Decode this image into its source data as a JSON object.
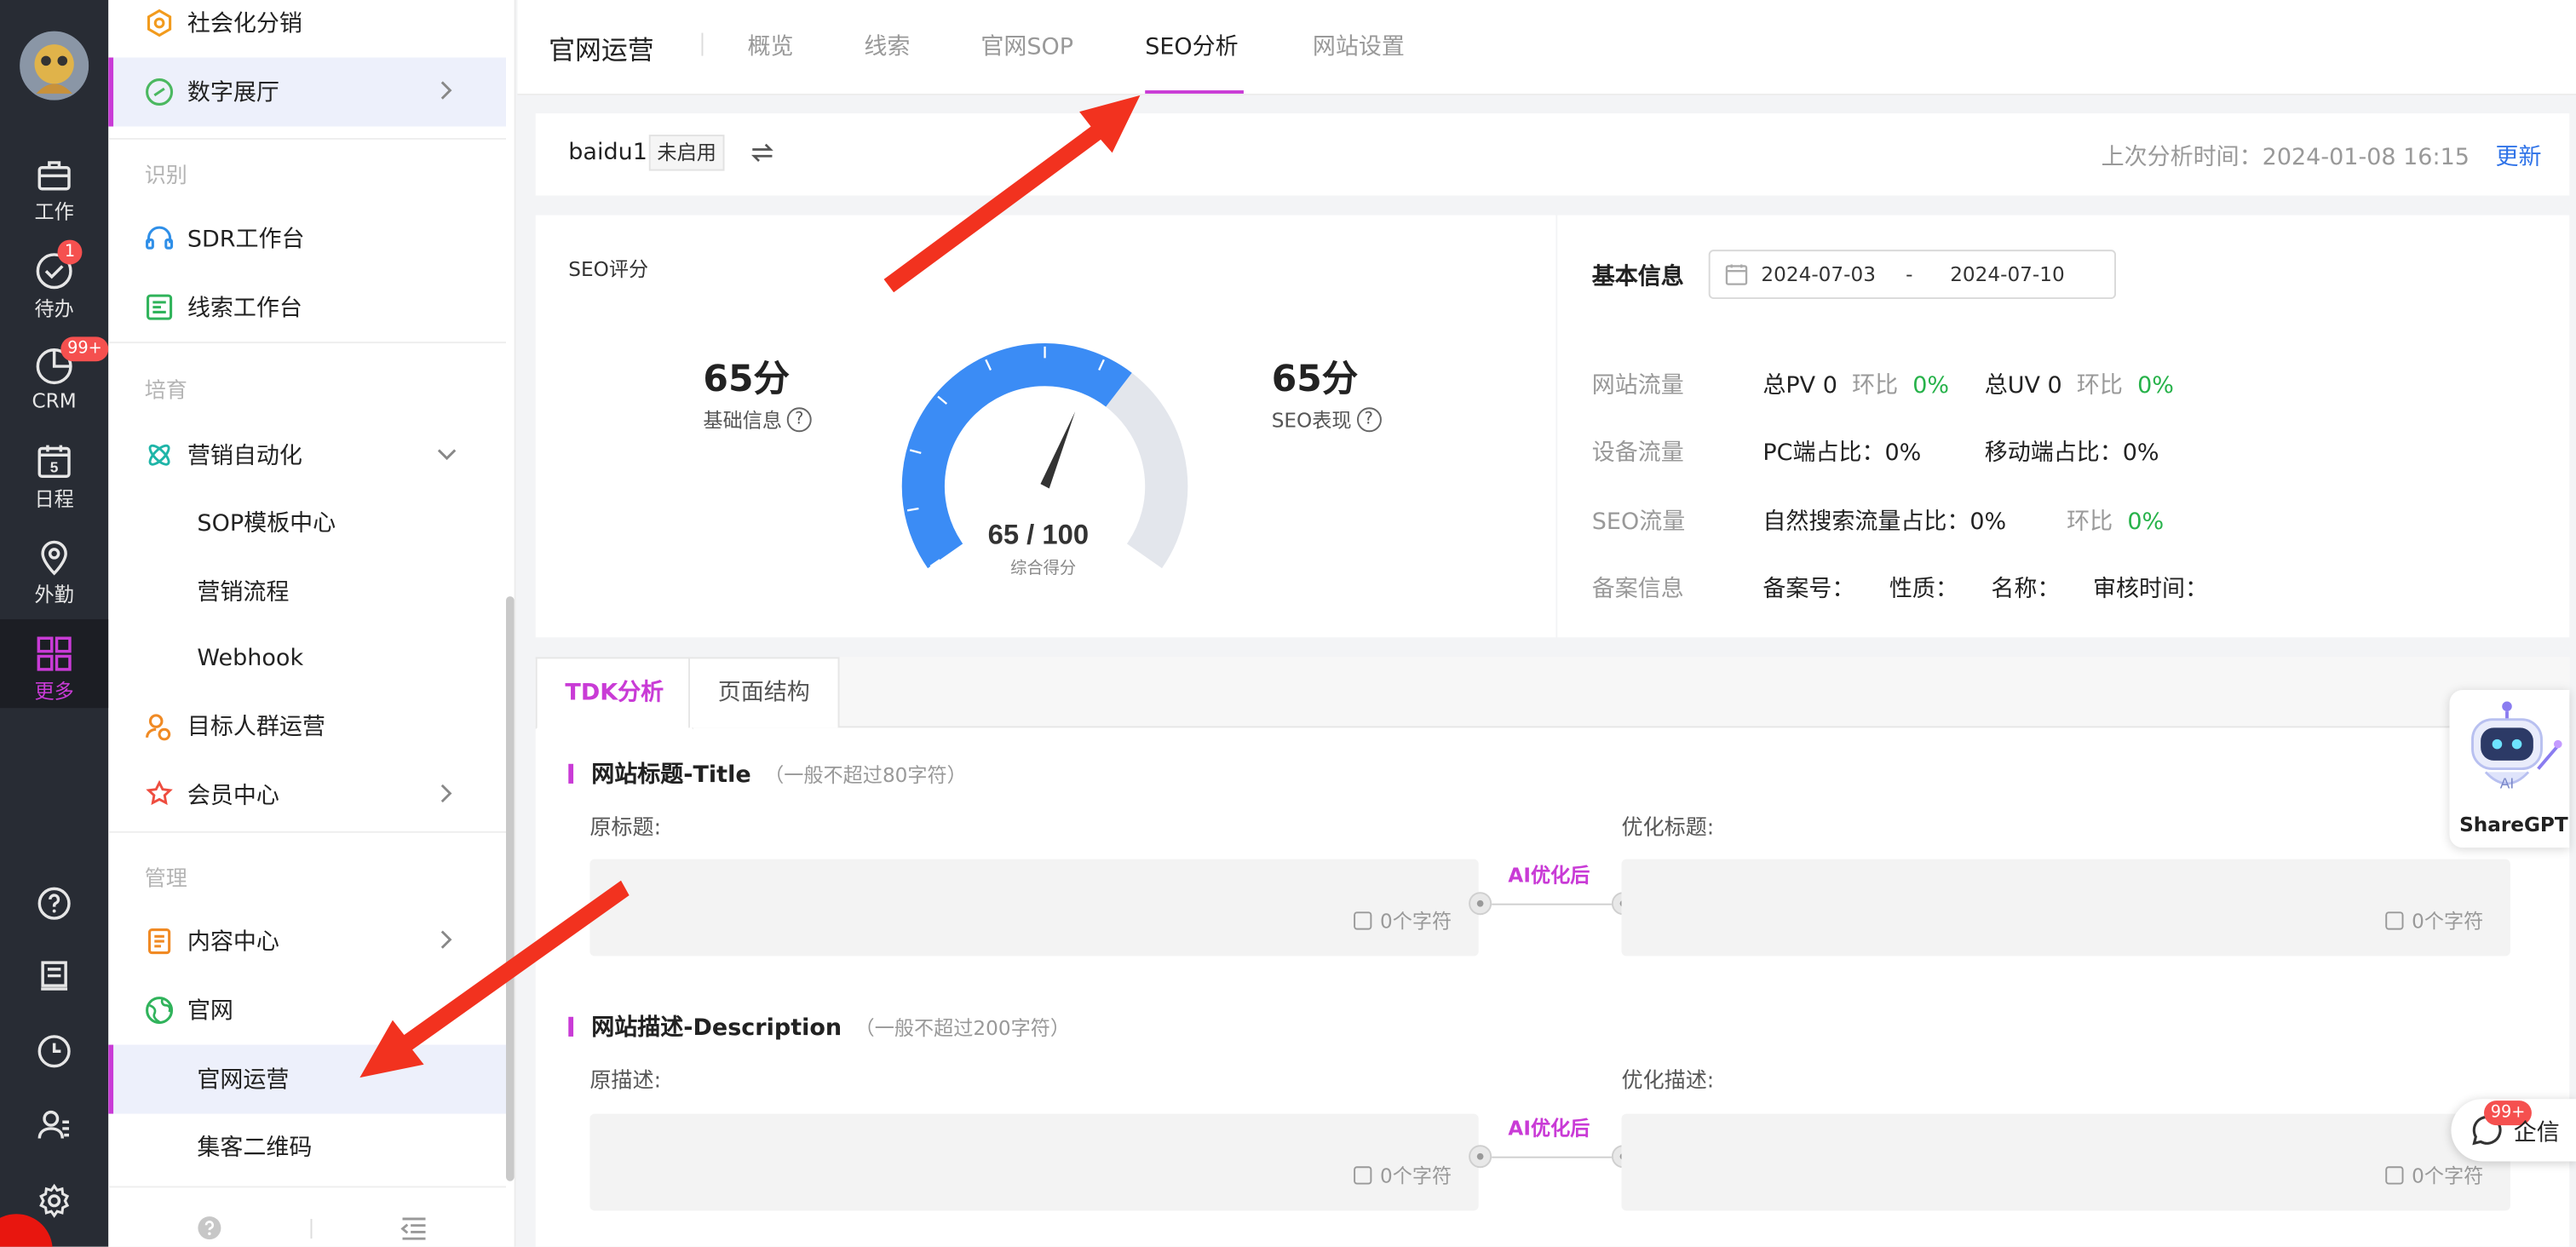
{
  "rail": {
    "items": [
      {
        "label": "工作",
        "icon": "briefcase-icon"
      },
      {
        "label": "待办",
        "icon": "check-circle-icon",
        "badge": "1"
      },
      {
        "label": "CRM",
        "icon": "pie-chart-icon",
        "badge": "99+"
      },
      {
        "label": "日程",
        "icon": "calendar-icon",
        "day": "5"
      },
      {
        "label": "外勤",
        "icon": "location-pin-icon"
      },
      {
        "label": "更多",
        "icon": "grid-icon"
      }
    ],
    "tools": [
      "help-icon",
      "notebook-icon",
      "clock-icon",
      "user-list-icon",
      "settings-icon"
    ]
  },
  "sidebar": {
    "items_top": [
      {
        "label": "社会化分销"
      },
      {
        "label": "数字展厅"
      }
    ],
    "sect_identify": "识别",
    "items_identify": [
      {
        "label": "SDR工作台"
      },
      {
        "label": "线索工作台"
      }
    ],
    "sect_nurture": "培育",
    "item_automation": "营销自动化",
    "sub_automation": [
      "SOP模板中心",
      "营销流程",
      "Webhook"
    ],
    "item_audience": "目标人群运营",
    "item_member": "会员中心",
    "sect_manage": "管理",
    "item_content": "内容中心",
    "item_site": "官网",
    "sub_site": [
      "官网运营",
      "集客二维码"
    ]
  },
  "header": {
    "title": "官网运营",
    "tabs": [
      "概览",
      "线索",
      "官网SOP",
      "SEO分析",
      "网站设置"
    ],
    "active_tab": "SEO分析"
  },
  "siterow": {
    "site": "baidu1",
    "tag": "未启用",
    "last_analysis": "上次分析时间：2024-01-08 16:15",
    "update": "更新"
  },
  "score": {
    "caption": "SEO评分",
    "basic_value": "65分",
    "basic_label": "基础信息",
    "seo_value": "65分",
    "seo_label": "SEO表现",
    "gauge_text": "65 / 100",
    "gauge_caption": "综合得分",
    "gauge_value": 65,
    "gauge_max": 100,
    "gauge_color": "#3b8cf5"
  },
  "info": {
    "caption": "基本信息",
    "date_start": "2024-07-03",
    "date_sep": "-",
    "date_end": "2024-07-10",
    "rows": {
      "traffic_label": "网站流量",
      "pv": "总PV 0",
      "pv_cmp": "环比",
      "pv_pct": "0%",
      "uv": "总UV 0",
      "uv_cmp": "环比",
      "uv_pct": "0%",
      "device_label": "设备流量",
      "pc": "PC端占比：0%",
      "mobile": "移动端占比：0%",
      "seo_label": "SEO流量",
      "natural": "自然搜索流量占比：0%",
      "seo_cmp": "环比",
      "seo_pct": "0%",
      "record_label": "备案信息",
      "record_no": "备案号：",
      "nature": "性质：",
      "name": "名称：",
      "audit": "审核时间："
    }
  },
  "tdk": {
    "tabs": [
      "TDK分析",
      "页面结构"
    ],
    "title_sec": {
      "heading": "网站标题-Title",
      "hint": "（一般不超过80字符）",
      "orig_label": "原标题:",
      "opt_label": "优化标题:",
      "ai_label": "AI优化后",
      "count_left": "0个字符",
      "count_right": "0个字符"
    },
    "desc_sec": {
      "heading": "网站描述-Description",
      "hint": "（一般不超过200字符）",
      "orig_label": "原描述:",
      "opt_label": "优化描述:",
      "ai_label": "AI优化后",
      "count_left": "0个字符",
      "count_right": "0个字符"
    }
  },
  "widgets": {
    "sharegpt": "ShareGPT",
    "robot_text": "AI",
    "qixin": "企信",
    "qixin_badge": "99+"
  },
  "colors": {
    "accent": "#c93bd6",
    "link": "#2f73e8",
    "positive": "#27b24a",
    "arrow": "#f2321f"
  }
}
